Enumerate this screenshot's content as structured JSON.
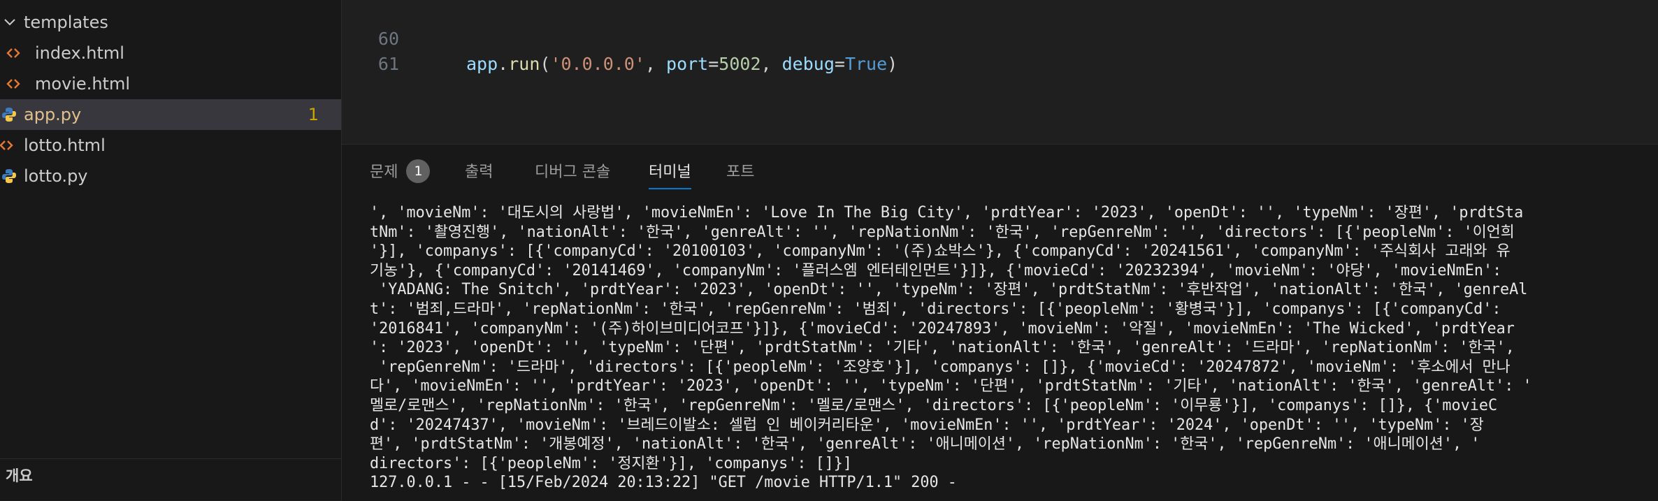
{
  "explorer": {
    "items": [
      {
        "label": "templates",
        "type": "folder",
        "expanded": true
      },
      {
        "label": "index.html",
        "type": "html"
      },
      {
        "label": "movie.html",
        "type": "html"
      },
      {
        "label": "app.py",
        "type": "python",
        "selected": true,
        "badge": "1"
      },
      {
        "label": "lotto.html",
        "type": "html"
      },
      {
        "label": "lotto.py",
        "type": "python"
      }
    ],
    "outline_title": "개요"
  },
  "editor": {
    "lines": [
      {
        "number": "60",
        "tokens": [
          {
            "text": "app",
            "kind": "var"
          },
          {
            "text": ".",
            "kind": "punc"
          },
          {
            "text": "run",
            "kind": "fn"
          },
          {
            "text": "(",
            "kind": "punc"
          },
          {
            "text": "'0.0.0.0'",
            "kind": "str"
          },
          {
            "text": ", ",
            "kind": "punc"
          },
          {
            "text": "port",
            "kind": "var"
          },
          {
            "text": "=",
            "kind": "punc"
          },
          {
            "text": "5002",
            "kind": "num"
          },
          {
            "text": ", ",
            "kind": "punc"
          },
          {
            "text": "debug",
            "kind": "var"
          },
          {
            "text": "=",
            "kind": "punc"
          },
          {
            "text": "True",
            "kind": "kw"
          },
          {
            "text": ")",
            "kind": "punc"
          }
        ]
      },
      {
        "number": "61",
        "tokens": []
      }
    ]
  },
  "panel": {
    "tabs": [
      {
        "label": "문제",
        "badge": "1"
      },
      {
        "label": "출력"
      },
      {
        "label": "디버그 콘솔"
      },
      {
        "label": "터미널",
        "active": true
      },
      {
        "label": "포트"
      }
    ]
  },
  "terminal": {
    "lines": [
      "', 'movieNm': '대도시의 사랑법', 'movieNmEn': 'Love In The Big City', 'prdtYear': '2023', 'openDt': '', 'typeNm': '장편', 'prdtSta",
      "tNm': '촬영진행', 'nationAlt': '한국', 'genreAlt': '', 'repNationNm': '한국', 'repGenreNm': '', 'directors': [{'peopleNm': '이언희",
      "'}], 'companys': [{'companyCd': '20100103', 'companyNm': '(주)쇼박스'}, {'companyCd': '20241561', 'companyNm': '주식회사 고래와 유",
      "기농'}, {'companyCd': '20141469', 'companyNm': '플러스엠 엔터테인먼트'}]}, {'movieCd': '20232394', 'movieNm': '야당', 'movieNmEn':",
      " 'YADANG: The Snitch', 'prdtYear': '2023', 'openDt': '', 'typeNm': '장편', 'prdtStatNm': '후반작업', 'nationAlt': '한국', 'genreAl",
      "t': '범죄,드라마', 'repNationNm': '한국', 'repGenreNm': '범죄', 'directors': [{'peopleNm': '황병국'}], 'companys': [{'companyCd':",
      "'2016841', 'companyNm': '(주)하이브미디어코프'}]}, {'movieCd': '20247893', 'movieNm': '악질', 'movieNmEn': 'The Wicked', 'prdtYear",
      "': '2023', 'openDt': '', 'typeNm': '단편', 'prdtStatNm': '기타', 'nationAlt': '한국', 'genreAlt': '드라마', 'repNationNm': '한국',",
      " 'repGenreNm': '드라마', 'directors': [{'peopleNm': '조양호'}], 'companys': []}, {'movieCd': '20247872', 'movieNm': '후소에서 만나",
      "다', 'movieNmEn': '', 'prdtYear': '2023', 'openDt': '', 'typeNm': '단편', 'prdtStatNm': '기타', 'nationAlt': '한국', 'genreAlt': '",
      "멜로/로맨스', 'repNationNm': '한국', 'repGenreNm': '멜로/로맨스', 'directors': [{'peopleNm': '이무룡'}], 'companys': []}, {'movieC",
      "d': '20247437', 'movieNm': '브레드이발소: 셀럽 인 베이커리타운', 'movieNmEn': '', 'prdtYear': '2024', 'openDt': '', 'typeNm': '장",
      "편', 'prdtStatNm': '개봉예정', 'nationAlt': '한국', 'genreAlt': '애니메이션', 'repNationNm': '한국', 'repGenreNm': '애니메이션', '",
      "directors': [{'peopleNm': '정지환'}], 'companys': []}]",
      "127.0.0.1 - - [15/Feb/2024 20:13:22] \"GET /movie HTTP/1.1\" 200 -"
    ]
  }
}
